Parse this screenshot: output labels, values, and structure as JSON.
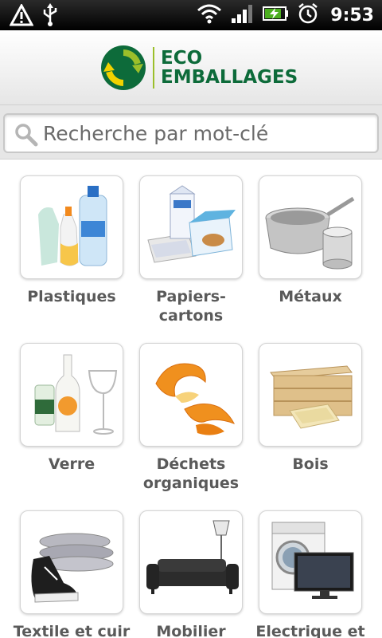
{
  "status_bar": {
    "time": "9:53",
    "icons": [
      "warning-icon",
      "usb-icon",
      "wifi-icon",
      "signal-icon",
      "battery-charging-icon",
      "alarm-icon"
    ]
  },
  "header": {
    "logo_line1": "ECO",
    "logo_line2": "EMBALLAGES",
    "brand_colors": {
      "green_dark": "#0d6b3a",
      "green_light": "#9bbf2a",
      "yellow": "#f2d200"
    }
  },
  "search": {
    "placeholder": "Recherche par mot-clé",
    "value": ""
  },
  "categories": [
    {
      "label": "Plastiques"
    },
    {
      "label": "Papiers-\ncartons"
    },
    {
      "label": "Métaux"
    },
    {
      "label": "Verre"
    },
    {
      "label": "Déchets\norganiques"
    },
    {
      "label": "Bois"
    },
    {
      "label": "Textile et cuir"
    },
    {
      "label": "Mobilier"
    },
    {
      "label": "Electrique et"
    }
  ]
}
